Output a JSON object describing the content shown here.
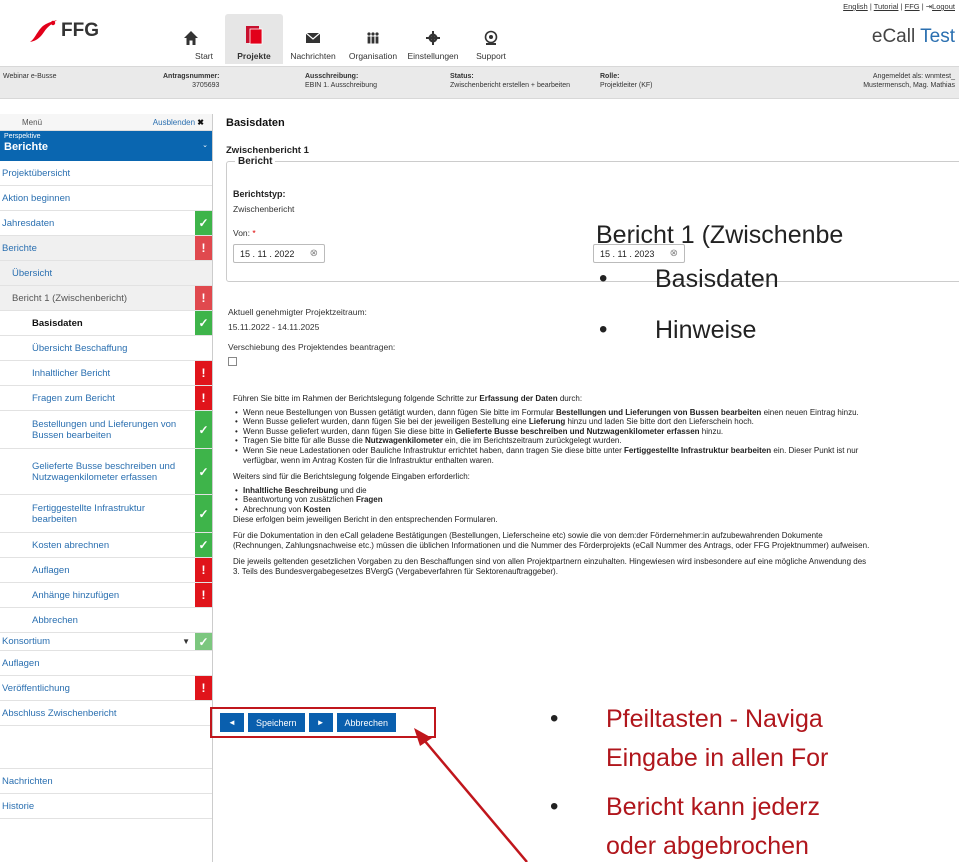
{
  "top_links": {
    "english": "English",
    "tutorial": "Tutorial",
    "ffg": "FFG",
    "logout": "Logout",
    "sep": "|"
  },
  "logo": {
    "text": "FFG"
  },
  "nav": {
    "start": "Start",
    "projekte": "Projekte",
    "nachrichten": "Nachrichten",
    "organisation": "Organisation",
    "einstellungen": "Einstellungen",
    "support": "Support"
  },
  "ecall": {
    "prefix": "eCall",
    "suffix": "Test"
  },
  "infobar": {
    "project": "Webinar e-Busse",
    "antrag_label": "Antragsnummer:",
    "antrag_value": "3705693",
    "ausschreibung_label": "Ausschreibung:",
    "ausschreibung_value": "EBIN 1. Ausschreibung",
    "status_label": "Status:",
    "status_value": "Zwischenbericht erstellen + bearbeiten",
    "rolle_label": "Rolle:",
    "rolle_value": "Projektleiter (KF)",
    "angemeldet": "Angemeldet als: wnmtest_",
    "user": "Mustermensch, Mag. Mathias"
  },
  "sidebar": {
    "menu": "Menü",
    "hide": "Ausblenden",
    "perspective_label": "Perspektive",
    "perspective_value": "Berichte",
    "items": [
      {
        "label": "Projektübersicht"
      },
      {
        "label": "Aktion beginnen"
      },
      {
        "label": "Jahresdaten",
        "status": "ok"
      },
      {
        "label": "Berichte",
        "status": "err"
      },
      {
        "label": "Übersicht"
      },
      {
        "label": "Bericht 1 (Zwischenbericht)",
        "status": "err"
      },
      {
        "label": "Basisdaten",
        "status": "ok"
      },
      {
        "label": "Übersicht Beschaffung"
      },
      {
        "label": "Inhaltlicher Bericht",
        "status": "err"
      },
      {
        "label": "Fragen zum Bericht",
        "status": "err"
      },
      {
        "label": "Bestellungen und Lieferungen von Bussen bearbeiten",
        "status": "ok"
      },
      {
        "label": "Gelieferte Busse beschreiben und Nutzwagenkilometer erfassen",
        "status": "ok"
      },
      {
        "label": "Fertiggestellte Infrastruktur bearbeiten",
        "status": "ok"
      },
      {
        "label": "Kosten abrechnen",
        "status": "ok"
      },
      {
        "label": "Auflagen",
        "status": "err"
      },
      {
        "label": "Anhänge hinzufügen",
        "status": "err"
      },
      {
        "label": "Abbrechen"
      },
      {
        "label": "Konsortium",
        "status": "ok"
      },
      {
        "label": "Auflagen"
      },
      {
        "label": "Veröffentlichung",
        "status": "err"
      },
      {
        "label": "Abschluss Zwischenbericht"
      },
      {
        "label": "Nachrichten"
      },
      {
        "label": "Historie"
      }
    ]
  },
  "main": {
    "title": "Basisdaten",
    "subtitle": "Zwischenbericht 1",
    "fieldset": "Bericht",
    "berichtstyp_label": "Berichtstyp:",
    "berichtstyp_value": "Zwischenbericht",
    "von_label": "Von:",
    "required": "*",
    "von_value": "15 . 11 . 2022",
    "bis_value": "15 . 11 . 2023",
    "zeitraum_label": "Aktuell genehmigter Projektzeitraum:",
    "zeitraum_value": "15.11.2022 - 14.11.2025",
    "verschiebung_label": "Verschiebung des Projektendes beantragen:"
  },
  "info": {
    "intro_a": "Führen Sie bitte im Rahmen der Berichtslegung folgende Schritte zur",
    "intro_b": "Erfassung der Daten",
    "intro_c": "durch:",
    "b1a": "Wenn neue Bestellungen von Bussen getätigt wurden, dann fügen Sie bitte im Formular",
    "b1b": "Bestellungen und Lieferungen von Bussen bearbeiten",
    "b1c": "einen neuen Eintrag hinzu.",
    "b2a": "Wenn Busse geliefert wurden, dann fügen Sie bei der jeweiligen Bestellung eine",
    "b2b": "Lieferung",
    "b2c": "hinzu und laden Sie bitte dort den Lieferschein hoch.",
    "b3a": "Wenn Busse geliefert wurden, dann fügen Sie diese bitte in",
    "b3b": "Gelieferte Busse beschreiben und Nutzwagenkilometer erfassen",
    "b3c": "hinzu.",
    "b4a": "Tragen Sie bitte für alle Busse die",
    "b4b": "Nutzwagenkilometer",
    "b4c": "ein, die im Berichtszeitraum zurückgelegt wurden.",
    "b5a": "Wenn Sie neue Ladestationen oder Bauliche Infrastruktur errichtet haben, dann tragen Sie diese bitte unter",
    "b5b": "Fertiggestellte Infrastruktur bearbeiten",
    "b5c": "ein. Dieser Punkt ist nur verfügbar, wenn im Antrag Kosten für die Infrastruktur enthalten waren.",
    "weiters": "Weiters sind für die Berichtslegung folgende Eingaben erforderlich:",
    "c1b": "Inhaltliche Beschreibung",
    "c1c": "und die",
    "c2a": "Beantwortung von zusätzlichen",
    "c2b": "Fragen",
    "c3a": "Abrechnung von",
    "c3b": "Kosten",
    "diese": "Diese erfolgen beim jeweiligen Bericht in den entsprechenden Formularen.",
    "doku": "Für die Dokumentation in den eCall geladene Bestätigungen (Bestellungen, Lieferscheine etc) sowie die von dem:der Fördernehmer:in aufzubewahrenden Dokumente (Rechnungen, Zahlungsnachweise etc.) müssen die üblichen Informationen und die Nummer des Förderprojekts (eCall Nummer des Antrags, oder FFG Projektnummer) aufweisen.",
    "vorgaben": "Die jeweils geltenden gesetzlichen Vorgaben zu den Beschaffungen sind von allen Projektpartnern einzuhalten. Hingewiesen wird insbesondere auf eine mögliche Anwendung des 3. Teils des Bundesvergabegesetzes BVergG (Vergabeverfahren für Sektorenauftraggeber)."
  },
  "buttons": {
    "prev": "◄",
    "save": "Speichern",
    "next": "►",
    "cancel": "Abbrechen"
  },
  "overlay": {
    "heading": "Bericht 1 (Zwischenbe",
    "b1": "Basisdaten",
    "b2": "Hinweise",
    "b3": "Pfeiltasten - Naviga",
    "b3_cont": "Eingabe in allen For",
    "b4": "Bericht kann jederz",
    "b4_cont": "oder abgebrochen"
  },
  "colors": {
    "accent": "#0a66b0",
    "ok": "#3eb44a",
    "err": "#e0141b",
    "callout": "#c0161c"
  }
}
